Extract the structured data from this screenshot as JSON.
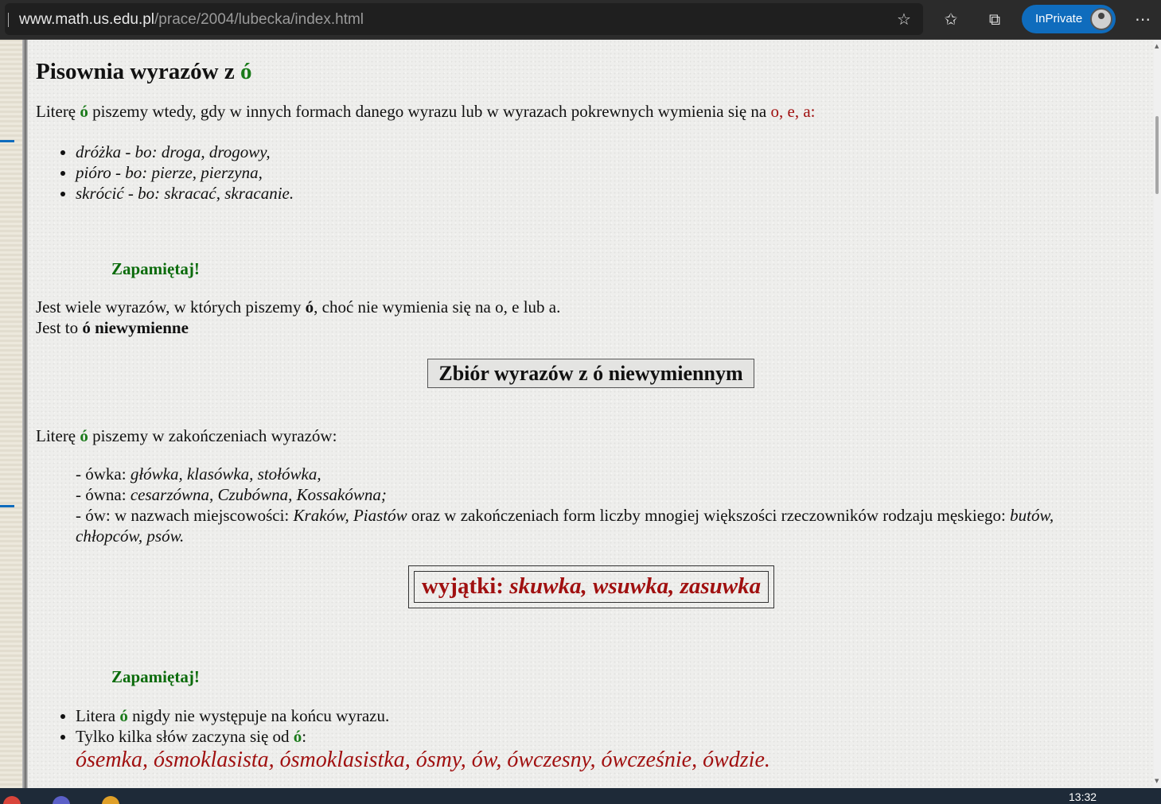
{
  "browser": {
    "url_host": "www.math.us.edu.pl",
    "url_path": "/prace/2004/lubecka/index.html",
    "inprivate_label": "InPrivate"
  },
  "page": {
    "title_text": "Pisownia wyrazów z ",
    "title_letter": "ó",
    "intro": {
      "pre": "Literę ",
      "letter": "ó",
      "mid": " piszemy wtedy, gdy w innych formach danego wyrazu lub w wyrazach pokrewnych wymienia się na ",
      "alts": "o, e, a:"
    },
    "examples": [
      {
        "word": "dróżka",
        "sep": " - ",
        "bo": "bo: ",
        "rel": "droga, drogowy,"
      },
      {
        "word": "pióro",
        "sep": " - ",
        "bo": "bo: ",
        "rel": "pierze, pierzyna,"
      },
      {
        "word": "skrócić",
        "sep": " - ",
        "bo": "bo: ",
        "rel": "skracać, skracanie."
      }
    ],
    "remember1": "Zapamiętaj!",
    "nonalt_line1_pre": "Jest wiele wyrazów, w których piszemy ",
    "nonalt_line1_letter": "ó",
    "nonalt_line1_post": ", choć nie wymienia się na o, e lub a.",
    "nonalt_line2_pre": "Jest to ",
    "nonalt_line2_bold": "ó niewymienne",
    "button_label": "Zbiór wyrazów z ó niewymiennym",
    "endings_intro_pre": "Literę ",
    "endings_intro_letter": "ó",
    "endings_intro_post": " piszemy w zakończeniach wyrazów:",
    "endings": {
      "owka_label": "- ówka: ",
      "owka_words": "główka, klasówka, stołówka,",
      "owna_label": "- ówna: ",
      "owna_words": "cesarzówna, Czubówna, Kossakówna;",
      "ow_label": "- ów: w nazwach miejscowości: ",
      "ow_places": "Kraków, Piastów",
      "ow_mid": " oraz w zakończeniach form liczby mnogiej większości rzeczowników rodzaju męskiego: ",
      "ow_words1": "butów,",
      "ow_words2": "chłopców, psów."
    },
    "exceptions_label": "wyjątki: ",
    "exceptions_words": "skuwka, wsuwka, zasuwka",
    "remember2": "Zapamiętaj!",
    "rule1_pre": "Litera ",
    "rule1_letter": "ó",
    "rule1_post": " nigdy nie występuje na końcu wyrazu.",
    "rule2_pre": "Tylko kilka słów zaczyna się od ",
    "rule2_letter": "ó",
    "rule2_post": ":",
    "start_words": "ósemka, ósmoklasista, ósmoklasistka, ósmy, ów, ówczesny, ówcześnie, ówdzie."
  },
  "taskbar": {
    "clock": "13:32"
  },
  "colors": {
    "accent_green": "#1a7a1a",
    "accent_red": "#a01010",
    "brand_blue": "#0f6cbd"
  }
}
